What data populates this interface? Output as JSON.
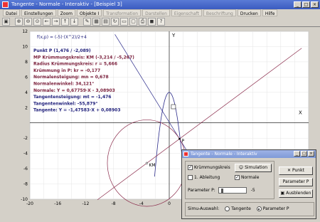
{
  "window": {
    "title": "Tangente - Normale - Interaktiv - [Beispiel 3]"
  },
  "menu": [
    {
      "label": "Datei",
      "enabled": true
    },
    {
      "label": "Einstellungen",
      "enabled": true
    },
    {
      "label": "Zoom",
      "enabled": true
    },
    {
      "label": "Objekte I",
      "enabled": true
    },
    {
      "label": "Transformation",
      "enabled": false
    },
    {
      "label": "Darstellen",
      "enabled": false
    },
    {
      "label": "Eigenschaft",
      "enabled": false
    },
    {
      "label": "Beschriftung",
      "enabled": false
    },
    {
      "label": "Drucken",
      "enabled": true
    },
    {
      "label": "Hilfe",
      "enabled": true
    }
  ],
  "plot": {
    "function_label": "f(x,p) = (-5)·(X^2)/2+4",
    "info_lines": [
      {
        "text": "Punkt P (1,476 / -2,089)",
        "color": "#1e1e7a"
      },
      {
        "text": "MP Krümmungskreis: KM (-3,214 / -5,267)",
        "color": "#7a1e3a"
      },
      {
        "text": "Radius Krümmungskreis: r = 5,666",
        "color": "#7a1e3a"
      },
      {
        "text": "Krümmung in P: kr = -0,177",
        "color": "#7a1e3a"
      },
      {
        "text": "Normalensteigung: mn = 0,678",
        "color": "#7a1e3a"
      },
      {
        "text": "Normalenwinkel: 34,121°",
        "color": "#7a1e3a"
      },
      {
        "text": "Normale: Y = 0,67759·X - 3,08903",
        "color": "#7a1e3a"
      },
      {
        "text": "Tangentensteigung: mt = -1,476",
        "color": "#1e1e7a"
      },
      {
        "text": "Tangentenwinkel: -55,879°",
        "color": "#1e1e7a"
      },
      {
        "text": "Tangente: Y = -1,47583·X + 0,08903",
        "color": "#1e1e7a"
      }
    ],
    "xticks": [
      "-20",
      "-16",
      "-12",
      "-8",
      "-4",
      "0",
      "4",
      "8",
      "12",
      "16",
      "20"
    ],
    "yticks": [
      "12",
      "10",
      "8",
      "6",
      "4",
      "2",
      "-2",
      "-4",
      "-6",
      "-8",
      "-10"
    ],
    "x_axis_label": "X",
    "y_axis_label": "Y",
    "point_label": "P",
    "center_label": "KM",
    "colors": {
      "curve": "#2a2a8a",
      "tangent": "#2a2a8a",
      "normal": "#8a2a4a",
      "circle": "#8a2a4a"
    }
  },
  "dialog": {
    "title": "Tangente - Normale - Interaktiv",
    "krummungskreis": {
      "label": "Krümmungskreis",
      "checked": true
    },
    "ableitung": {
      "label": "1. Ableitung",
      "checked": false
    },
    "simulation_label": "Simulation",
    "normale": {
      "label": "Normale",
      "checked": true
    },
    "punkt_label": "Punkt",
    "parameter_btn_label": "Parameter P",
    "ausblenden_label": "Ausblenden",
    "parameter_label": "Parameter P:",
    "parameter_value": "-5",
    "simu_label": "Simu-Auswahl:",
    "radio_tangente": {
      "label": "Tangente",
      "checked": false
    },
    "radio_parameter": {
      "label": "Parameter P",
      "checked": true
    }
  }
}
